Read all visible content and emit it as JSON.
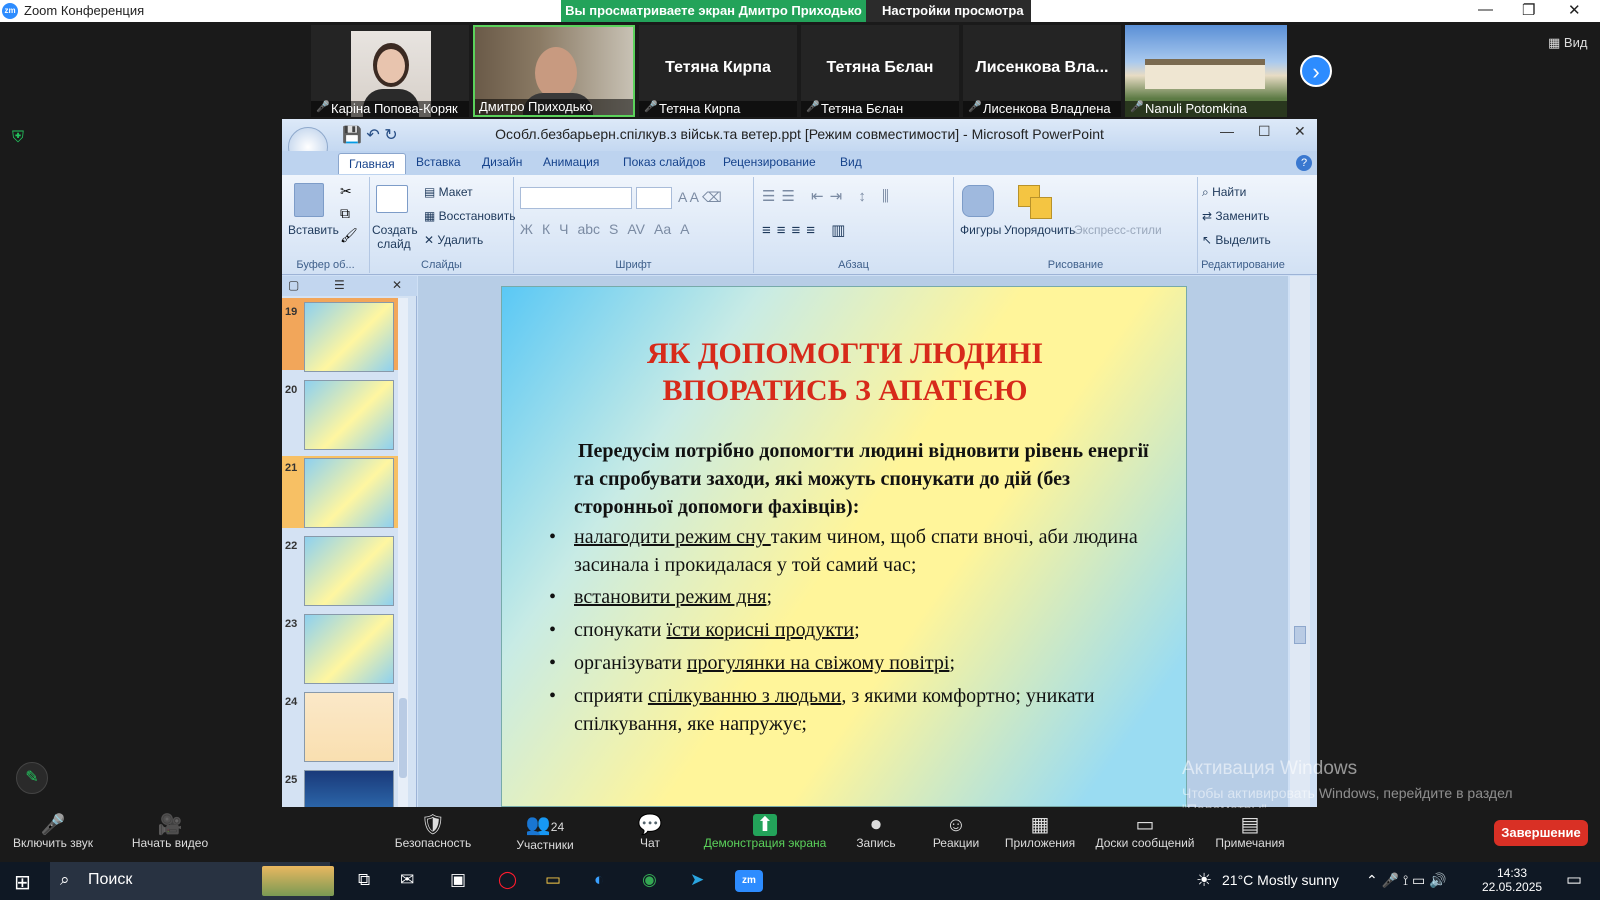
{
  "window": {
    "title": "Zoom Конференция",
    "minimize": "—",
    "restore": "❐",
    "close": "✕"
  },
  "share": {
    "text": "Вы просматриваете экран Дмитро Приходько",
    "settings": "Настройки просмотра",
    "chevron": "⌄"
  },
  "view_btn": "Вид",
  "participants": [
    {
      "name": "Каріна Попова-Коряк",
      "video": true
    },
    {
      "name": "Дмитро Приходько",
      "video": true
    },
    {
      "name": "Тетяна Кирпа",
      "big": "Тетяна Кирпа"
    },
    {
      "name": "Тетяна Бєлан",
      "big": "Тетяна Бєлан"
    },
    {
      "name": "Лисенкова Владлена",
      "big": "Лисенкова  Вла..."
    },
    {
      "name": "Nanuli Potomkina",
      "video": true
    }
  ],
  "ppt": {
    "doc_title": "Особл.безбарьерн.спілкув.з військ.та ветер.ppt [Режим совместимости] - Microsoft PowerPoint",
    "tabs": [
      "Главная",
      "Вставка",
      "Дизайн",
      "Анимация",
      "Показ слайдов",
      "Рецензирование",
      "Вид"
    ],
    "groups": {
      "clipboard": "Буфер об...",
      "slides": "Слайды",
      "font": "Шрифт",
      "paragraph": "Абзац",
      "drawing": "Рисование",
      "editing": "Редактирование"
    },
    "buttons": {
      "paste": "Вставить",
      "new_slide": "Создать слайд",
      "layout": "Макет",
      "reset": "Восстановить",
      "delete": "Удалить",
      "shapes": "Фигуры",
      "arrange": "Упорядочить",
      "quick_styles": "Экспресс-стили",
      "find": "Найти",
      "replace": "Заменить",
      "select": "Выделить"
    },
    "font_btns": [
      "Ж",
      "К",
      "Ч",
      "abc",
      "S",
      "AV",
      "Aa",
      "A"
    ],
    "thumbs": [
      "19",
      "20",
      "21",
      "22",
      "23",
      "24",
      "25"
    ],
    "slide": {
      "title": "ЯК ДОПОМОГТИ ЛЮДИНІ ВПОРАТИСЬ З АПАТІЄЮ",
      "intro": "Передусім потрібно допомогти людині відновити рівень енергії та спробувати заходи, які можуть спонукати до дій (без сторонньої допомоги фахівців):",
      "bullets": [
        {
          "u": "налагодити режим сну ",
          "rest": "таким чином, щоб спати вночі, аби людина засинала і прокидалася у той самий час;"
        },
        {
          "u": "встановити режим дня",
          "rest": ";"
        },
        {
          "pre": "спонукати ",
          "u": "їсти корисні продукти",
          "rest": ";"
        },
        {
          "pre": "організувати ",
          "u": "прогулянки на свіжому повітрі",
          "rest": ";"
        },
        {
          "pre": "сприяти ",
          "u": "спілкуванню з людьми",
          "rest": ", з якими комфортно; уникати спілкування, яке напружує;"
        }
      ]
    }
  },
  "activation": {
    "title": "Активация Windows",
    "sub": "Чтобы активировать Windows, перейдите в раздел \"Параметры\"."
  },
  "toolbar": [
    {
      "label": "Включить звук",
      "icon": "🎤"
    },
    {
      "label": "Начать видео",
      "icon": "🎥"
    },
    {
      "label": "Безопасность",
      "icon": "🛡"
    },
    {
      "label": "Участники",
      "icon": "👥",
      "count": "24"
    },
    {
      "label": "Чат",
      "icon": "💬"
    },
    {
      "label": "Демонстрация экрана",
      "icon": "⬆"
    },
    {
      "label": "Запись",
      "icon": "⏺"
    },
    {
      "label": "Реакции",
      "icon": "☺"
    },
    {
      "label": "Приложения",
      "icon": "▦"
    },
    {
      "label": "Доски сообщений",
      "icon": "▭"
    },
    {
      "label": "Примечания",
      "icon": "▤"
    }
  ],
  "end_label": "Завершение",
  "taskbar": {
    "search": "Поиск",
    "weather": "21°C  Mostly sunny",
    "time": "14:33",
    "date": "22.05.2025"
  },
  "colors": {
    "share_green": "#23a35a",
    "end_red": "#d93025",
    "slide_title": "#d72a1a"
  }
}
